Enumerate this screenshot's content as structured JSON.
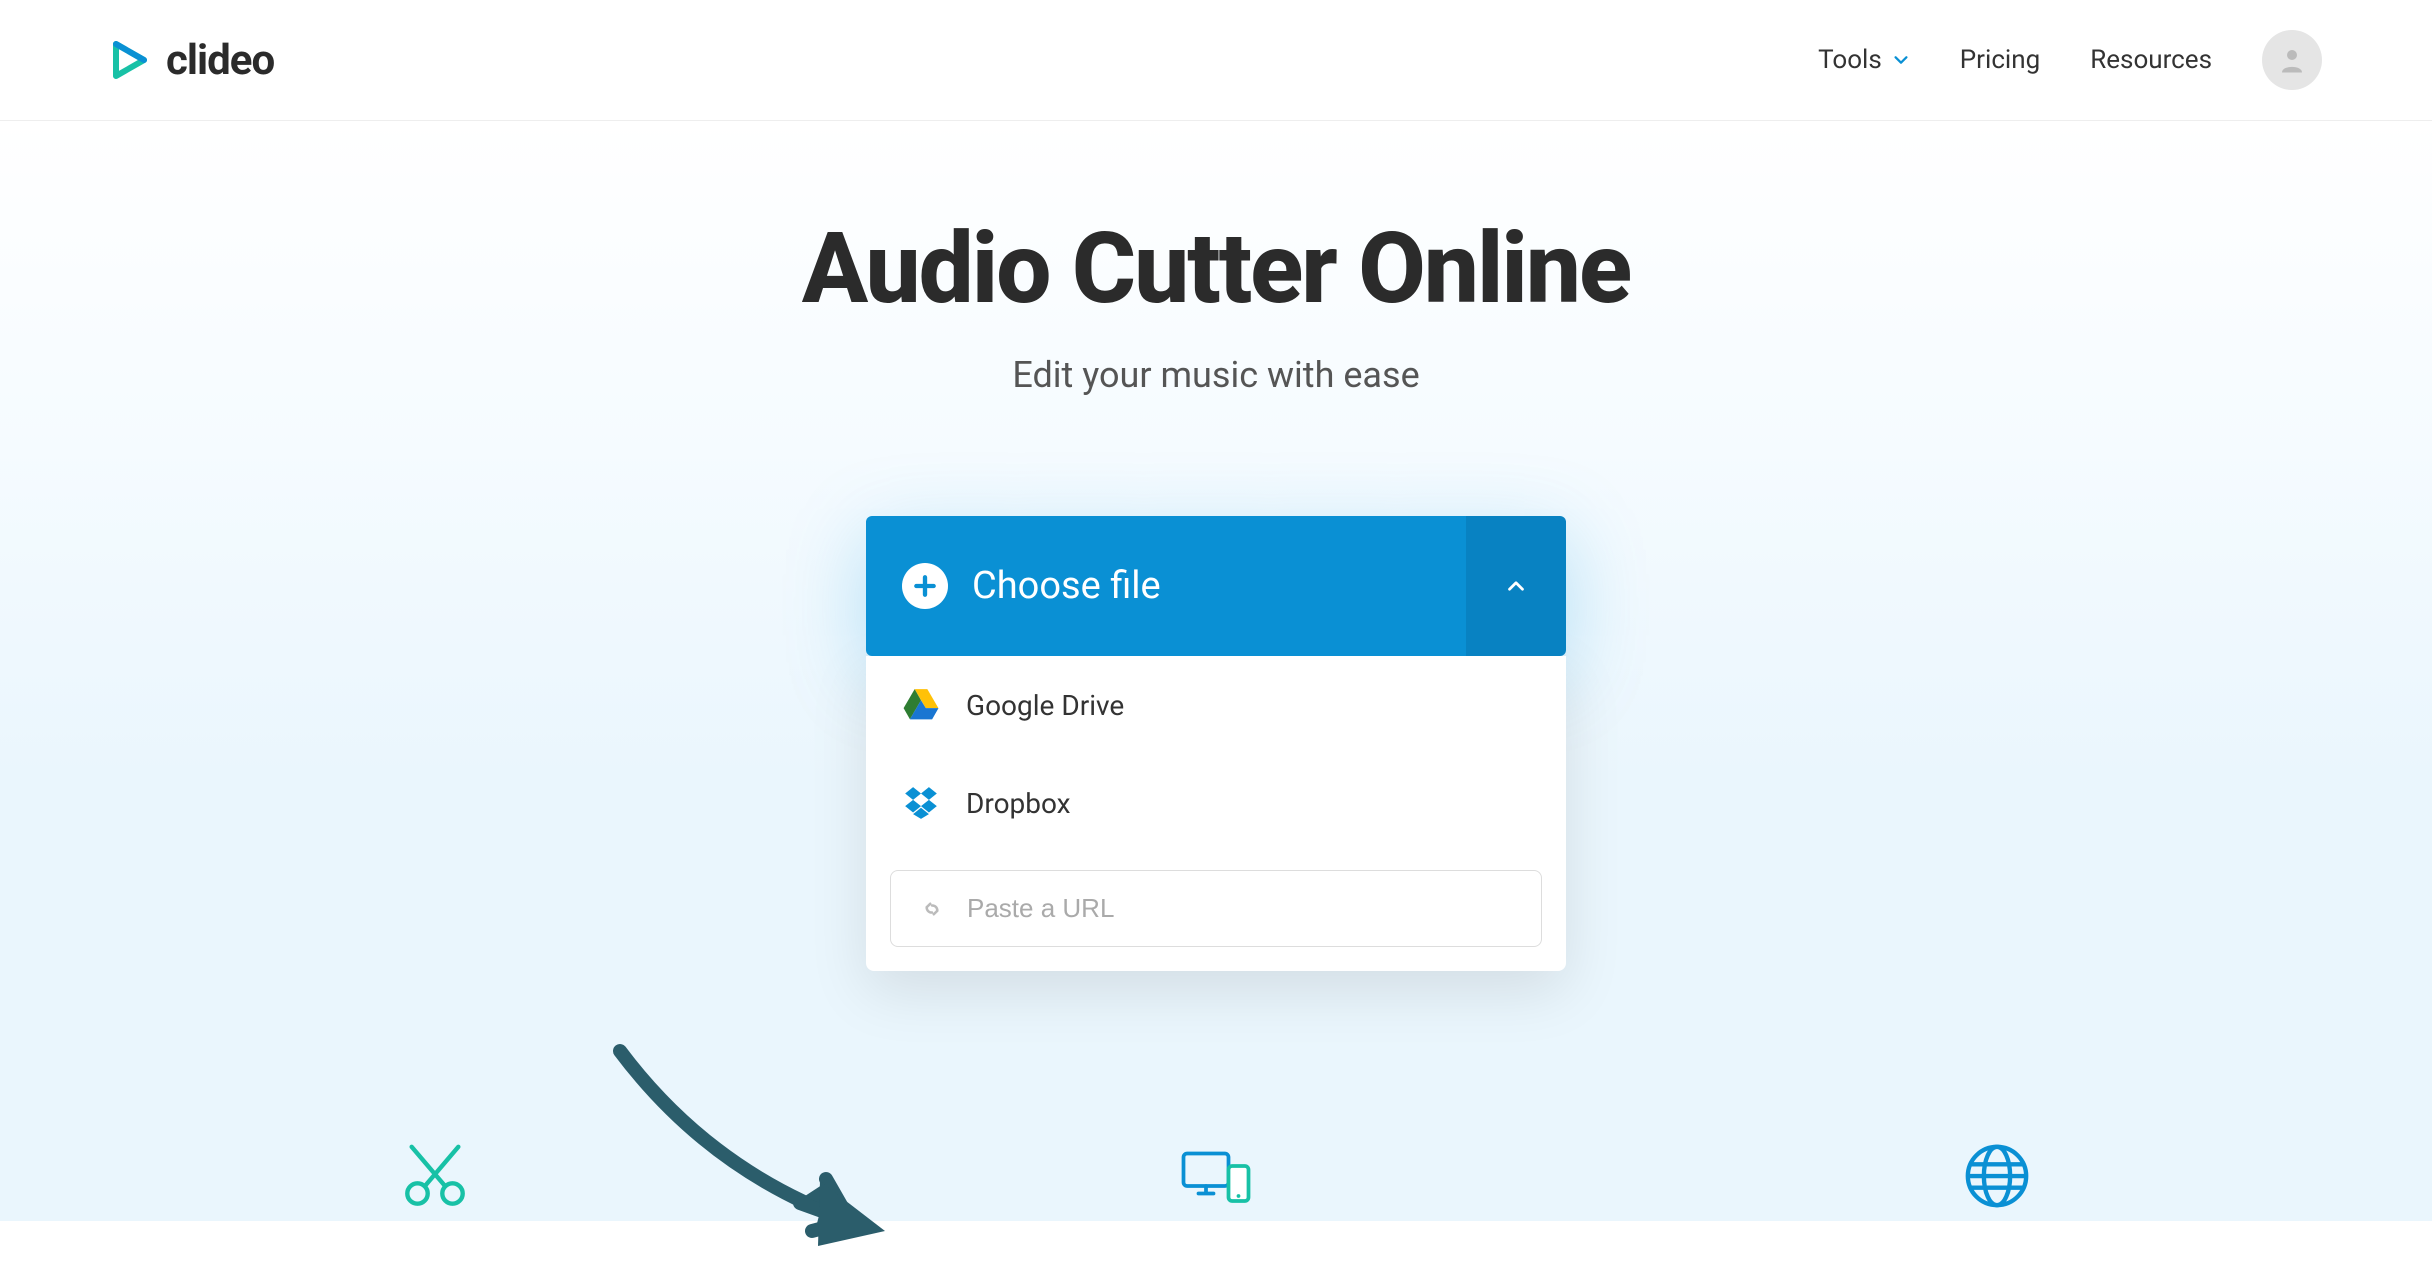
{
  "header": {
    "brand": "clideo",
    "nav": {
      "tools": "Tools",
      "pricing": "Pricing",
      "resources": "Resources"
    }
  },
  "hero": {
    "title": "Audio Cutter Online",
    "subtitle": "Edit your music with ease"
  },
  "upload": {
    "choose_label": "Choose file",
    "options": {
      "gdrive": "Google Drive",
      "dropbox": "Dropbox"
    },
    "url_placeholder": "Paste a URL"
  }
}
